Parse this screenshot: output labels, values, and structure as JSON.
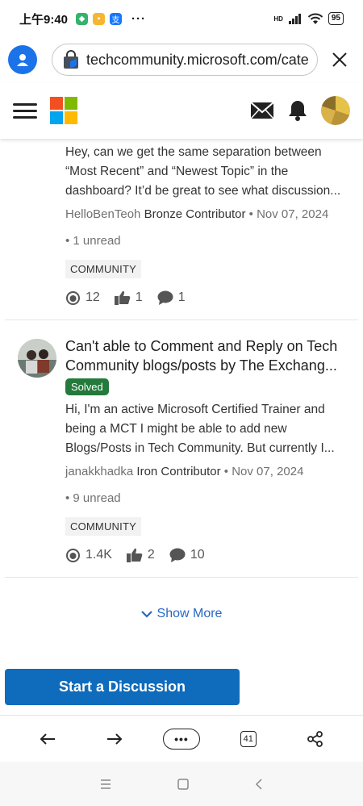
{
  "status": {
    "time": "上午9:40",
    "more": "···",
    "network": "HD",
    "battery": "95"
  },
  "browser": {
    "url": "techcommunity.microsoft.com/cate"
  },
  "header": {
    "logo_colors": [
      "#f25022",
      "#7fba00",
      "#00a4ef",
      "#ffb900"
    ]
  },
  "posts": [
    {
      "body": "Hey, can we get the same separation between “Most Recent” and “Newest Topic” in the dashboard? It’d be great to see what discussion...",
      "author": "HelloBenTeoh",
      "rank": "Bronze Contributor",
      "date": "• Nov 07, 2024",
      "unread": "• 1 unread",
      "tag": "COMMUNITY",
      "views": "12",
      "likes": "1",
      "replies": "1"
    },
    {
      "title": "Can't able to Comment and Reply on Tech Community blogs/posts by The Exchang...",
      "badge": "Solved",
      "body": "Hi, I'm an active Microsoft Certified Trainer and being a MCT I might be able to add new Blogs/Posts in Tech Community. But currently I...",
      "author": "janakkhadka",
      "rank": "Iron Contributor",
      "date": "• Nov 07, 2024",
      "unread": "• 9 unread",
      "tag": "COMMUNITY",
      "views": "1.4K",
      "likes": "2",
      "replies": "10"
    }
  ],
  "show_more": "Show More",
  "start_discussion": "Start a Discussion",
  "toolbar": {
    "tab_count": "41",
    "more": "•••"
  },
  "colors": {
    "accent": "#0f6cbd",
    "solved": "#237a3b",
    "link": "#2768c2"
  }
}
